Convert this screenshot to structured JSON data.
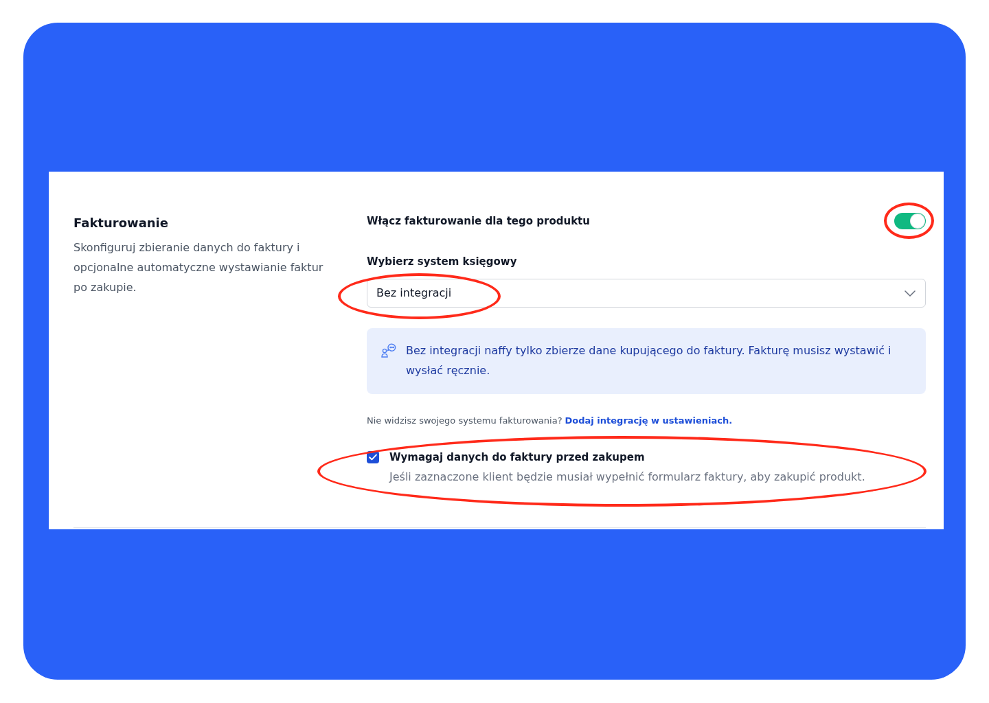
{
  "section": {
    "title": "Fakturowanie",
    "description": "Skonfiguruj zbieranie danych do faktury i opcjonalne automatyczne wystawianie faktur po zakupie."
  },
  "billing_toggle": {
    "label": "Włącz fakturowanie dla tego produktu",
    "on": true,
    "highlighted": true
  },
  "accounting_system": {
    "label": "Wybierz system księgowy",
    "value": "Bez integracji",
    "highlighted": true
  },
  "info": {
    "text": "Bez integracji naffy tylko zbierze dane kupującego do faktury. Fakturę musisz wystawić i wysłać ręcznie."
  },
  "hint": {
    "text": "Nie widzisz swojego systemu fakturowania?",
    "link": "Dodaj integrację w ustawieniach."
  },
  "require_invoice_data": {
    "label": "Wymagaj danych do faktury przed zakupem",
    "description": "Jeśli zaznaczone klient będzie musiał wypełnić formularz faktury, aby zakupić produkt.",
    "checked": true,
    "highlighted": true
  }
}
